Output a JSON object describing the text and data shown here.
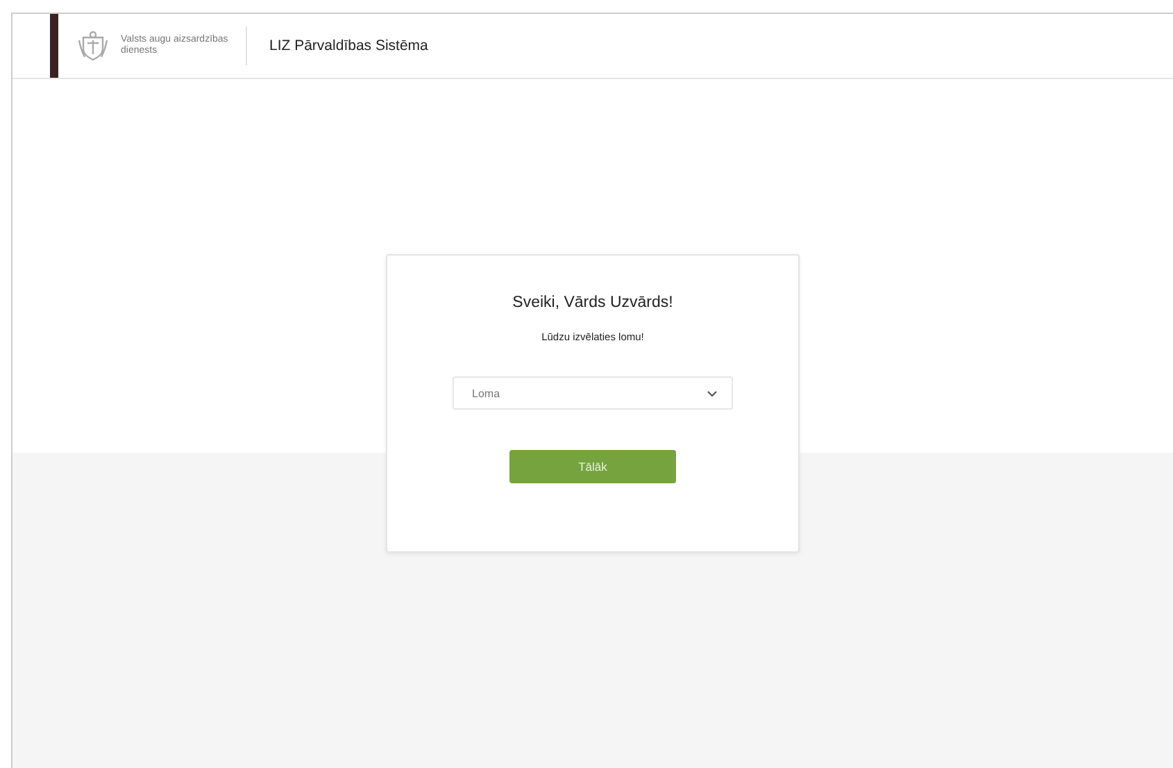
{
  "header": {
    "organization": "Valsts augu aizsardzības dienests",
    "app_title": "LIZ Pārvaldības Sistēma"
  },
  "card": {
    "greeting": "Sveiki, Vārds Uzvārds!",
    "prompt": "Lūdzu izvēlaties lomu!",
    "role_select": {
      "placeholder": "Loma"
    },
    "button": "Tālāk"
  }
}
